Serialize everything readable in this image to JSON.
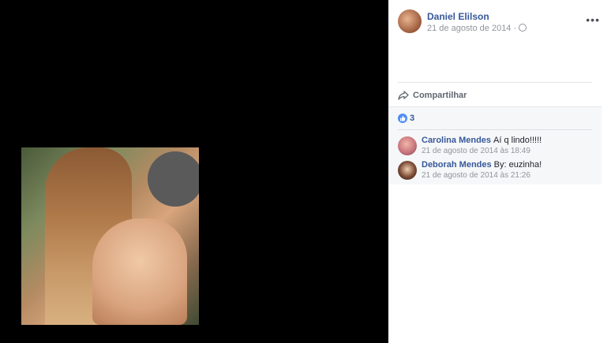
{
  "post": {
    "author": "Daniel Elilson",
    "date": "21 de agosto de 2014 ·",
    "more": "•••"
  },
  "actions": {
    "share_label": "Compartilhar"
  },
  "reactions": {
    "like_count": "3"
  },
  "comments": [
    {
      "name": "Carolina Mendes",
      "text": "Aí q lindo!!!!!",
      "time": "21 de agosto de 2014 às 18:49"
    },
    {
      "name": "Deborah Mendes",
      "text": "By: euzinha!",
      "time": "21 de agosto de 2014 às 21:26"
    }
  ],
  "colors": {
    "link": "#365899",
    "viewer_bg": "#000000",
    "like_badge": "#4f8df6"
  },
  "icons": [
    "globe-icon",
    "share-icon",
    "like-icon",
    "more-options-icon"
  ]
}
